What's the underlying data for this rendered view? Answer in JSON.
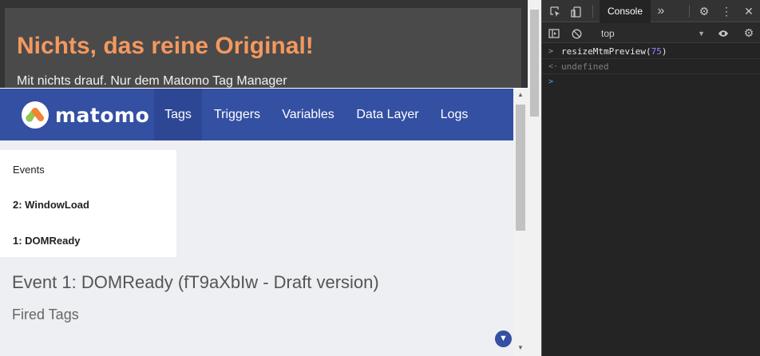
{
  "page": {
    "hero_title": "Nichts, das reine Original!",
    "hero_subtitle": "Mit nichts drauf. Nur dem Matomo Tag Manager"
  },
  "preview": {
    "brand": "matomo",
    "nav": [
      {
        "label": "Tags",
        "active": true
      },
      {
        "label": "Triggers",
        "active": false
      },
      {
        "label": "Variables",
        "active": false
      },
      {
        "label": "Data Layer",
        "active": false
      },
      {
        "label": "Logs",
        "active": false
      }
    ],
    "events_header": "Events",
    "events": [
      "2: WindowLoad",
      "1: DOMReady"
    ],
    "event_title": "Event 1: DOMReady (fT9aXbIw - Draft version)",
    "fired_tags_label": "Fired Tags",
    "collapse_icon": "chevron-down-icon"
  },
  "devtools": {
    "active_tab": "Console",
    "context": "top",
    "console": {
      "command_fn": "resizeMtmPreview(",
      "command_arg": "75",
      "command_close": ")",
      "result": "undefined"
    }
  },
  "colors": {
    "hero_title": "#f4985f",
    "matomo_nav": "#3450a3",
    "devtools_bg": "#242424"
  }
}
